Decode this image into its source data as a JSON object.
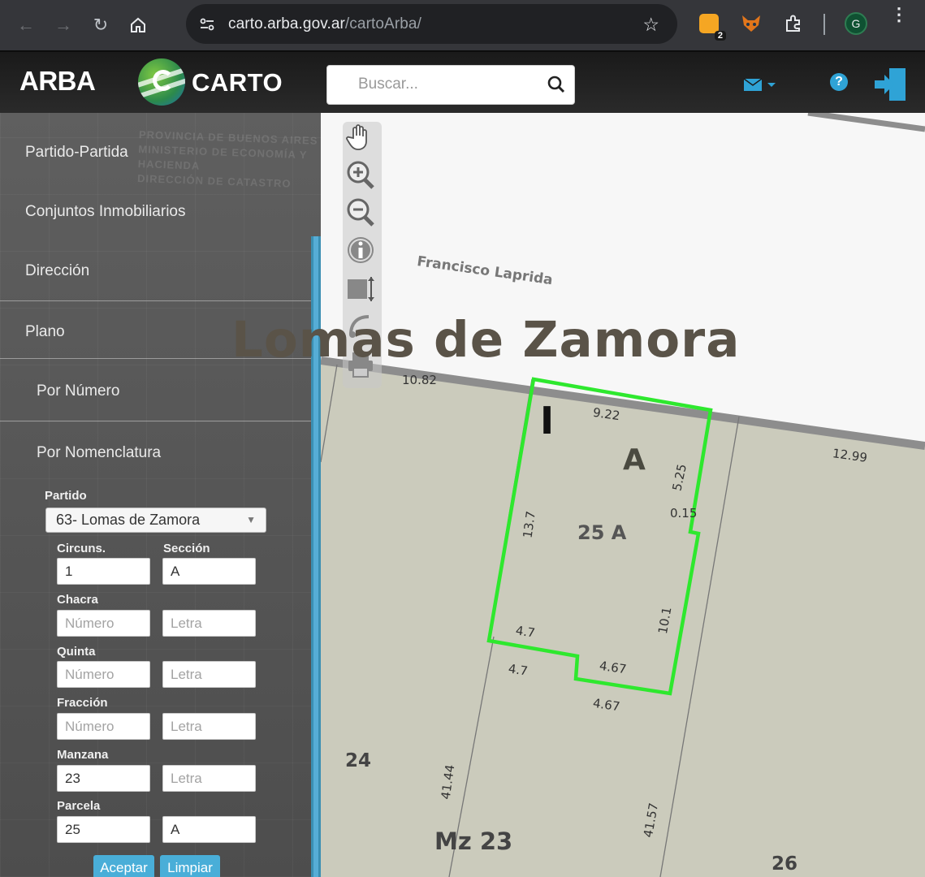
{
  "browser": {
    "url_domain": "carto.arba.gov.ar",
    "url_path": "/cartoArba/",
    "extension_badge": "2",
    "profile_initial": "G"
  },
  "header": {
    "brand": "ARBA",
    "product": "CARTO",
    "search_placeholder": "Buscar..."
  },
  "sidebar": {
    "stamp_lines": [
      "PROVINCIA DE BUENOS AIRES",
      "MINISTERIO DE ECONOMÍA Y HACIENDA",
      "DIRECCIÓN DE CATASTRO"
    ],
    "menu": {
      "partido": "Partido-Partida",
      "conjuntos": "Conjuntos Inmobiliarios",
      "direccion": "Dirección",
      "plano": "Plano",
      "por_numero": "Por Número",
      "por_nomenclatura": "Por Nomenclatura"
    },
    "form": {
      "partido_label": "Partido",
      "partido_value": "63- Lomas de Zamora",
      "circuns_label": "Circuns.",
      "circuns_value": "1",
      "seccion_label": "Sección",
      "seccion_value": "A",
      "chacra_label": "Chacra",
      "quinta_label": "Quinta",
      "fraccion_label": "Fracción",
      "manzana_label": "Manzana",
      "manzana_value": "23",
      "parcela_label": "Parcela",
      "parcela_value": "25",
      "parcela_letra_value": "A",
      "placeholder_numero": "Número",
      "placeholder_letra": "Letra"
    },
    "buttons": {
      "aceptar": "Aceptar",
      "limpiar": "Limpiar"
    }
  },
  "map": {
    "city": "Lomas de Zamora",
    "street": "Francisco Laprida",
    "circ_marker": "I",
    "section_marker": "A",
    "parcel_id": "25 A",
    "manzana": "Mz 23",
    "neighbor_left": "24",
    "neighbor_right": "26",
    "highlight_color": "#2ee82e",
    "dimensions": {
      "d1082": "10.82",
      "d922": "9.22",
      "d1299": "12.99",
      "d525": "5.25",
      "d015": "0.15",
      "d137": "13.7",
      "d101": "10.1",
      "d47a": "4.7",
      "d47b": "4.7",
      "d467a": "4.67",
      "d467b": "4.67",
      "d4144": "41.44",
      "d4157": "41.57"
    }
  }
}
